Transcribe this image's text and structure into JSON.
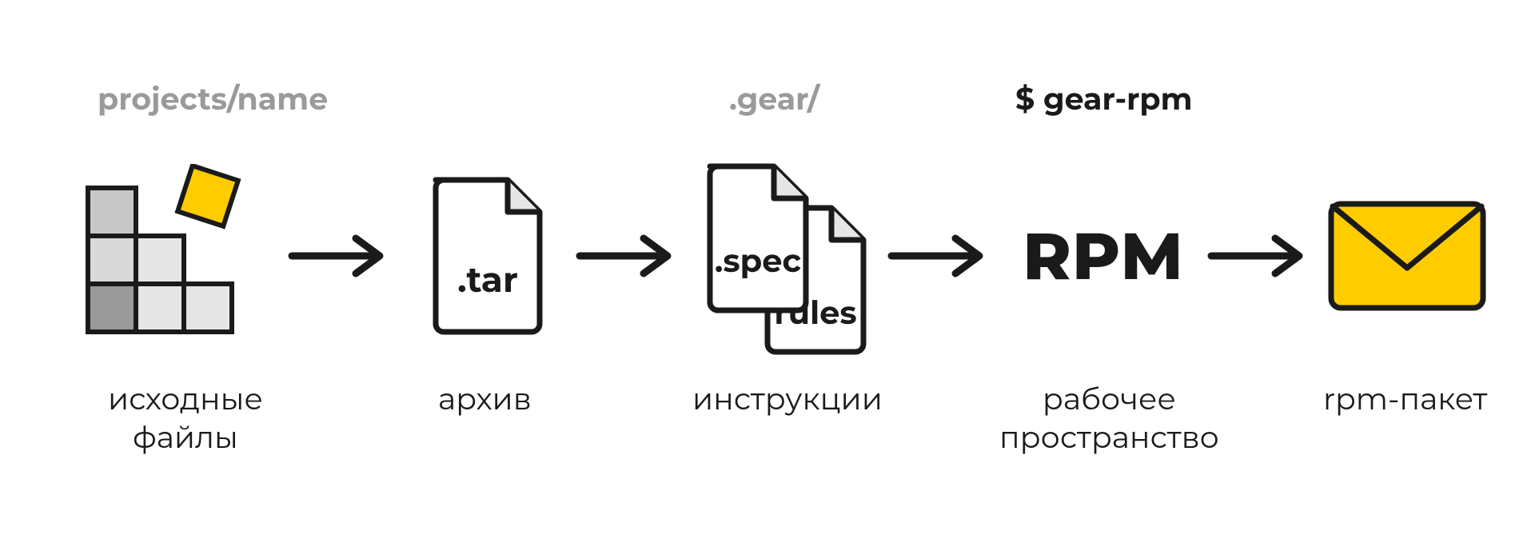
{
  "top": {
    "projects": "projects/name",
    "gear": ".gear/",
    "cmd": "$ gear-rpm"
  },
  "step1": {
    "caption1": "исходные",
    "caption2": "файлы"
  },
  "step2": {
    "file_label": ".tar",
    "caption": "архив"
  },
  "step3": {
    "file1_label": ".spec",
    "file2_label": "rules",
    "caption": "инструкции"
  },
  "step4": {
    "icon_text": "RPM",
    "caption1": "рабочее",
    "caption2": "пространство"
  },
  "step5": {
    "caption": "rpm-пакет"
  },
  "colors": {
    "accent": "#ffcc00",
    "stroke": "#1a1a1a",
    "grey_dark": "#9a9a9a",
    "grey_mid": "#c7c7c7",
    "grey_light": "#d9d9d9",
    "grey_lighter": "#e6e6e6"
  }
}
